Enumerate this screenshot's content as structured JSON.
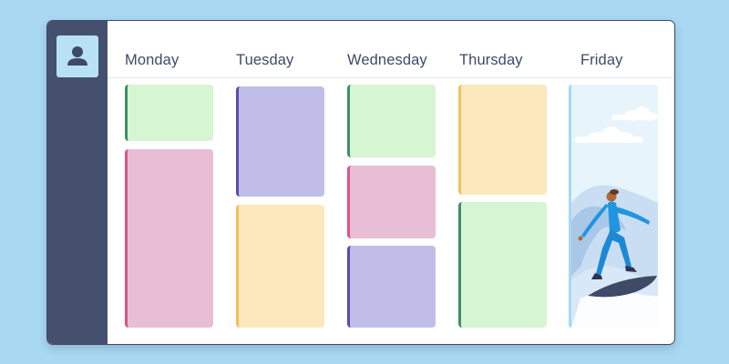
{
  "calendar": {
    "days": [
      {
        "label": "Monday"
      },
      {
        "label": "Tuesday"
      },
      {
        "label": "Wednesday"
      },
      {
        "label": "Thursday"
      },
      {
        "label": "Friday"
      }
    ]
  },
  "icons": {
    "avatar": "user-icon",
    "friday_image": "surfer-illustration"
  },
  "colors": {
    "page_background": "#a8d8f2",
    "sidebar": "#44506e",
    "event_green": "#d6f5d2",
    "event_pink": "#e8bdd6",
    "event_purple": "#c0bee8",
    "event_yellow": "#fce8bd"
  }
}
